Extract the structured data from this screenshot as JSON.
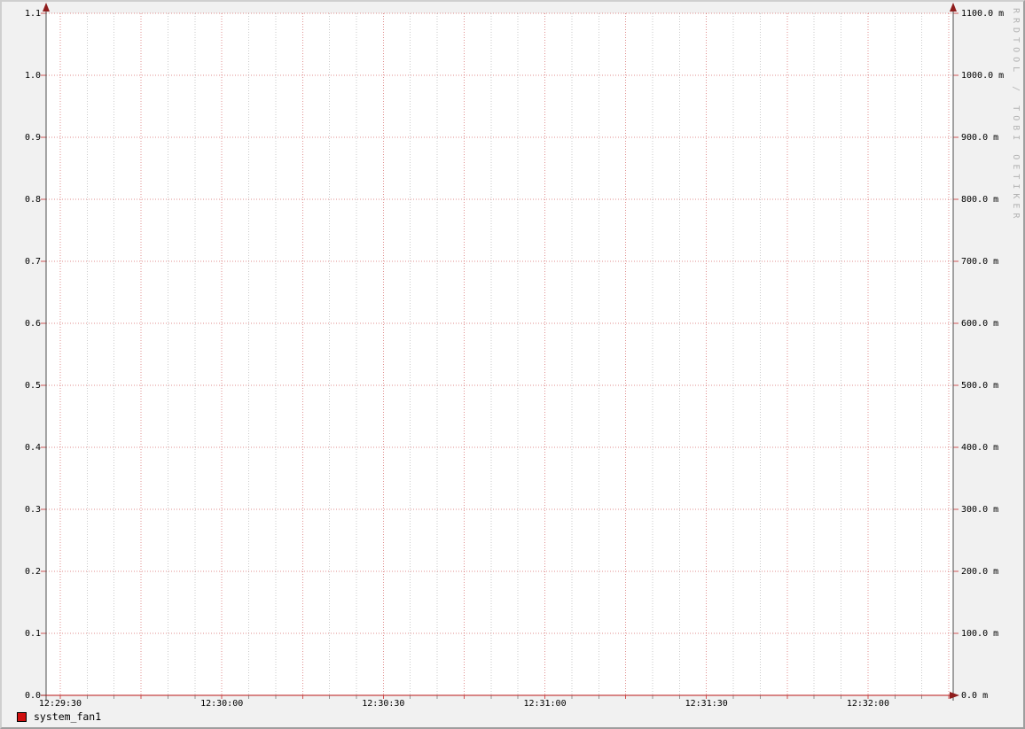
{
  "watermark": "RRDTOOL / TOBI OETIKER",
  "legend": {
    "items": [
      {
        "label": "system_fan1",
        "color": "#d01010"
      }
    ]
  },
  "left_axis": {
    "ticks": [
      "1.1",
      "1.0",
      "0.9",
      "0.8",
      "0.7",
      "0.6",
      "0.5",
      "0.4",
      "0.3",
      "0.2",
      "0.1",
      "0.0"
    ]
  },
  "right_axis": {
    "ticks": [
      "1100.0 m",
      "1000.0 m",
      "900.0 m",
      "800.0 m",
      "700.0 m",
      "600.0 m",
      "500.0 m",
      "400.0 m",
      "300.0 m",
      "200.0 m",
      "100.0 m",
      "0.0 m"
    ]
  },
  "x_axis": {
    "labels": [
      "12:29:30",
      "12:30:00",
      "12:30:30",
      "12:31:00",
      "12:31:30",
      "12:32:00"
    ]
  },
  "chart_data": {
    "type": "line",
    "title": "",
    "x": [
      "12:29:30",
      "12:30:00",
      "12:30:30",
      "12:31:00",
      "12:31:30",
      "12:32:00"
    ],
    "series": [
      {
        "name": "system_fan1",
        "color": "#d01010",
        "values": [
          0,
          0,
          0,
          0,
          0,
          0
        ]
      }
    ],
    "xlabel": "",
    "ylabel": "",
    "ylim": [
      0.0,
      1.1
    ],
    "y_right_lim": [
      0.0,
      1100.0
    ],
    "y_right_unit": "m",
    "grid": true,
    "minor_x_grid_seconds": 5,
    "major_x_grid_seconds": 15,
    "legend_position": "bottom-left"
  },
  "colors": {
    "background": "#f1f1f1",
    "canvas": "#ffffff",
    "major_grid": "#cc4444",
    "minor_grid": "#8a8a8a",
    "axis": "#4d4d4d",
    "x_axis_line": "#9b1a1a",
    "arrow": "#8f1d1d",
    "text": "#000000",
    "watermark_text": "#b4b4b4",
    "series_red": "#d01010"
  }
}
